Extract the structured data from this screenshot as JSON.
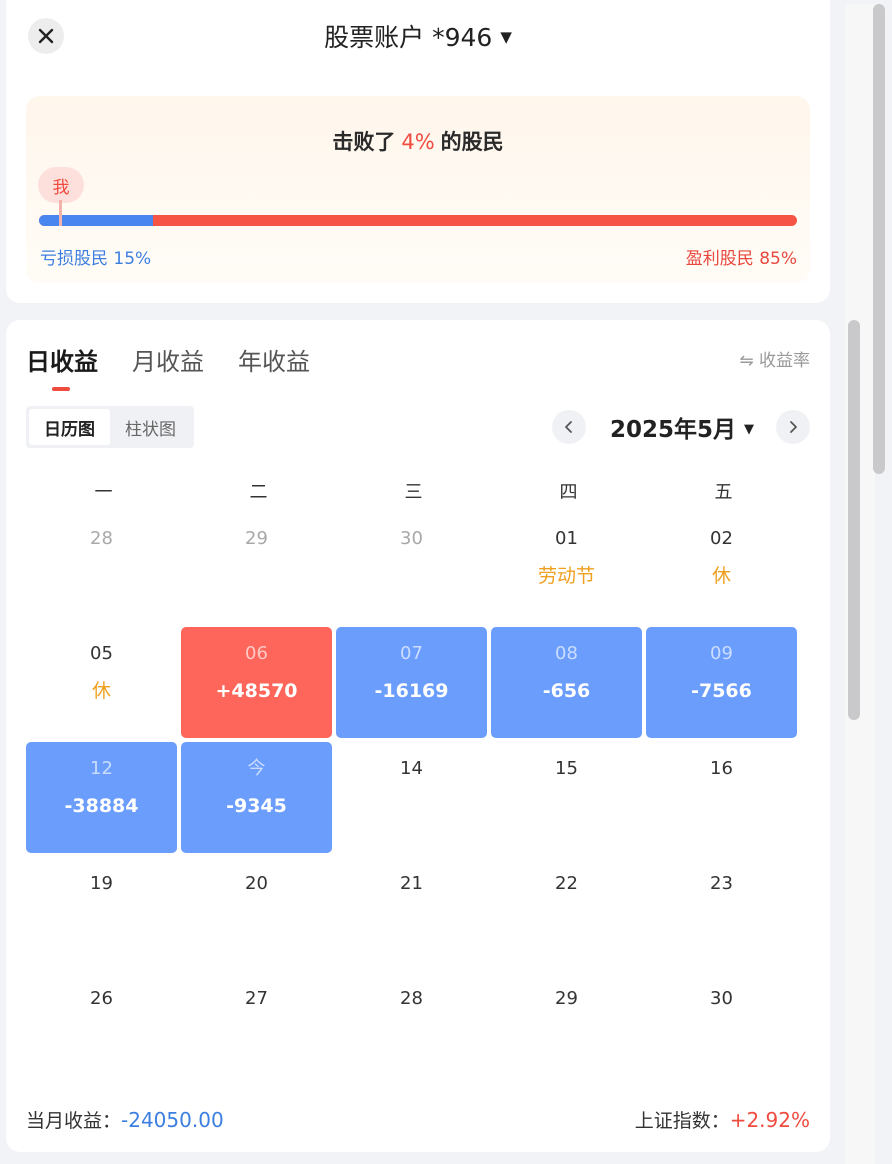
{
  "header": {
    "title": "股票账户 *946",
    "close_icon": "close-icon",
    "caret": "▼"
  },
  "ranking": {
    "prefix": "击败了",
    "percent": "4%",
    "suffix": "的股民",
    "me_label": "我",
    "loss_label": "亏损股民 15%",
    "gain_label": "盈利股民 85%",
    "loss_fraction": 0.15,
    "me_fraction": 0.04,
    "colors": {
      "loss": "#4a86ef",
      "gain": "#f65445"
    }
  },
  "tabs": [
    {
      "label": "日收益",
      "active": true
    },
    {
      "label": "月收益",
      "active": false
    },
    {
      "label": "年收益",
      "active": false
    }
  ],
  "rate_toggle": "⇋ 收益率",
  "view_toggle": [
    {
      "label": "日历图",
      "active": true
    },
    {
      "label": "柱状图",
      "active": false
    }
  ],
  "month_nav": {
    "label": "2025年5月",
    "caret": "▼",
    "prev_icon": "chevron-left-icon",
    "next_icon": "chevron-right-icon"
  },
  "weekdays": [
    "一",
    "二",
    "三",
    "四",
    "五"
  ],
  "calendar": [
    {
      "day": "28",
      "sub": "",
      "type": "other"
    },
    {
      "day": "29",
      "sub": "",
      "type": "other"
    },
    {
      "day": "30",
      "sub": "",
      "type": "other"
    },
    {
      "day": "01",
      "sub": "劳动节",
      "type": "holiday"
    },
    {
      "day": "02",
      "sub": "休",
      "type": "holiday"
    },
    {
      "day": "05",
      "sub": "休",
      "type": "holiday"
    },
    {
      "day": "06",
      "sub": "+48570",
      "type": "gain"
    },
    {
      "day": "07",
      "sub": "-16169",
      "type": "loss"
    },
    {
      "day": "08",
      "sub": "-656",
      "type": "loss"
    },
    {
      "day": "09",
      "sub": "-7566",
      "type": "loss"
    },
    {
      "day": "12",
      "sub": "-38884",
      "type": "loss"
    },
    {
      "day": "今",
      "sub": "-9345",
      "type": "loss"
    },
    {
      "day": "14",
      "sub": "",
      "type": "normal"
    },
    {
      "day": "15",
      "sub": "",
      "type": "normal"
    },
    {
      "day": "16",
      "sub": "",
      "type": "normal"
    },
    {
      "day": "19",
      "sub": "",
      "type": "normal"
    },
    {
      "day": "20",
      "sub": "",
      "type": "normal"
    },
    {
      "day": "21",
      "sub": "",
      "type": "normal"
    },
    {
      "day": "22",
      "sub": "",
      "type": "normal"
    },
    {
      "day": "23",
      "sub": "",
      "type": "normal"
    },
    {
      "day": "26",
      "sub": "",
      "type": "normal"
    },
    {
      "day": "27",
      "sub": "",
      "type": "normal"
    },
    {
      "day": "28",
      "sub": "",
      "type": "normal"
    },
    {
      "day": "29",
      "sub": "",
      "type": "normal"
    },
    {
      "day": "30",
      "sub": "",
      "type": "normal"
    }
  ],
  "footer": {
    "month_label": "当月收益：",
    "month_value": "-24050.00",
    "index_label": "上证指数：",
    "index_value": "+2.92%"
  }
}
